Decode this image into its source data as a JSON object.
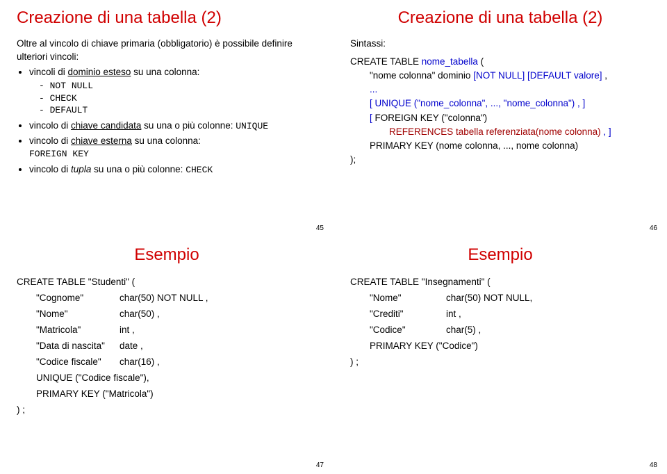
{
  "slide45": {
    "title": "Creazione di una tabella (2)",
    "intro": "Oltre al vincolo di chiave primaria (obbligatorio) è possibile definire ulteriori vincoli:",
    "item1_pre": "vincoli di ",
    "item1_u": "dominio esteso",
    "item1_post": " su una colonna:",
    "sub1a": "NOT NULL",
    "sub1b": "CHECK",
    "sub1c": "DEFAULT",
    "item2_pre": "vincolo di ",
    "item2_u": "chiave candidata",
    "item2_post": " su una o più colonne: ",
    "item2_code": "UNIQUE",
    "item3_pre": "vincolo di ",
    "item3_u": "chiave esterna",
    "item3_post": " su una colonna: ",
    "item3_code": "FOREIGN KEY",
    "item4_pre": "vincolo di ",
    "item4_em": "tupla",
    "item4_post": " su una o più colonne: ",
    "item4_code": "CHECK",
    "pagenum": "45"
  },
  "slide46": {
    "title": "Creazione di una tabella (2)",
    "sintassi_label": "Sintassi:",
    "line1a": "CREATE TABLE ",
    "line1b": "nome_tabella",
    "line1c": " (",
    "line2a": "\"nome colonna\"  dominio  ",
    "line2b": "[NOT NULL] [DEFAULT valore] ",
    "line2c": ",",
    "line3": "...",
    "line4a": "[ UNIQUE (\"nome_colonna\", ..., \"nome_colonna\") , ]",
    "line5a": "[ ",
    "line5b": "FOREIGN KEY (\"colonna\")",
    "line6a": "REFERENCES tabella referenziata(nome colonna) ",
    "line6b": ", ]",
    "line7a": "PRIMARY KEY (nome colonna, ..., nome colonna)",
    "line8": ");",
    "pagenum": "46"
  },
  "slide47": {
    "title": "Esempio",
    "l1": "CREATE  TABLE  \"Studenti\" (",
    "l2a": "\"Cognome\"",
    "l2b": "char(50) NOT NULL ,",
    "l3a": "\"Nome\"",
    "l3b": "char(50) ,",
    "l4a": "\"Matricola\"",
    "l4b": "int ,",
    "l5a": "\"Data di nascita\"",
    "l5b": "date ,",
    "l6a": "\"Codice fiscale\"",
    "l6b": "char(16) ,",
    "l7": "UNIQUE (\"Codice fiscale\"),",
    "l8": "PRIMARY KEY (\"Matricola\")",
    "l9": ") ;",
    "pagenum": "47"
  },
  "slide48": {
    "title": "Esempio",
    "l1": "CREATE  TABLE  \"Insegnamenti\" (",
    "l2a": "\"Nome\"",
    "l2b": "char(50) NOT NULL,",
    "l3a": "\"Crediti\"",
    "l3b": "int ,",
    "l4a": "\"Codice\"",
    "l4b": "char(5) ,",
    "l5": "PRIMARY KEY (\"Codice\")",
    "l6": ") ;",
    "pagenum": "48"
  }
}
